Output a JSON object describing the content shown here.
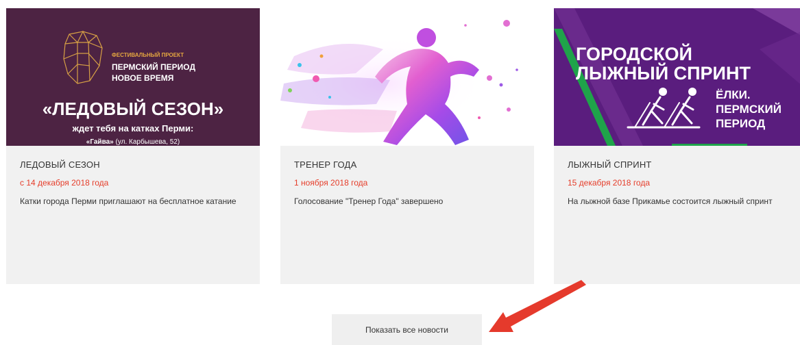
{
  "news": [
    {
      "title": "ЛЕДОВЫЙ СЕЗОН",
      "date": "с 14 декабря 2018 года",
      "description": "Катки города Перми приглашают на бесплатное катание",
      "image": {
        "project_label": "ФЕСТИВАЛЬНЫЙ ПРОЕКТ",
        "project_line1": "ПЕРМСКИЙ ПЕРИОД",
        "project_line2": "НОВОЕ ВРЕМЯ",
        "headline": "«ЛЕДОВЫЙ СЕЗОН»",
        "subline": "ждет тебя на катках Перми:",
        "venue_name": "«Гайва»",
        "venue_address": " (ул. Карбышева, 52)",
        "background": "#4d2343"
      }
    },
    {
      "title": "ТРЕНЕР ГОДА",
      "date": "1 ноября 2018 года",
      "description": "Голосование \"Тренер Года\" завершено",
      "image": {
        "icon": "watercolor-runner-icon"
      }
    },
    {
      "title": "ЛЫЖНЫЙ СПРИНТ",
      "date": "15 декабря 2018 года",
      "description": "На лыжной базе Прикамье состоится лыжный спринт",
      "image": {
        "headline1": "ГОРОДСКОЙ",
        "headline2": "ЛЫЖНЫЙ СПРИНТ",
        "side1": "ЁЛКИ.",
        "side2": "ПЕРМСКИЙ",
        "side3": "ПЕРИОД",
        "background": "#5a1d7e",
        "accent": "#1fa34a"
      }
    }
  ],
  "show_all_label": "Показать все новости",
  "colors": {
    "date": "#e53d2a",
    "arrow": "#e53a2c"
  }
}
